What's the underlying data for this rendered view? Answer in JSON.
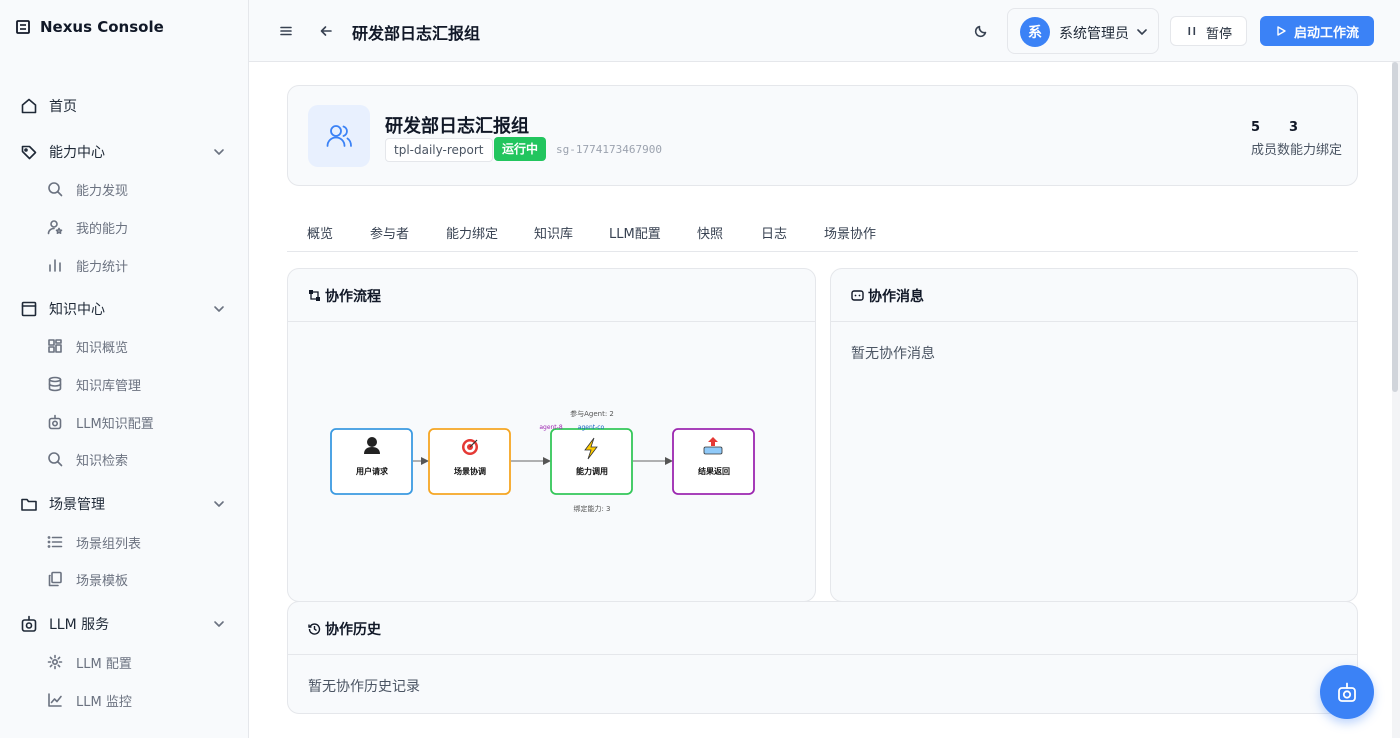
{
  "app": {
    "brand": "Nexus Console"
  },
  "sidebar": {
    "groups": [
      {
        "label": "首页",
        "icon": "home-icon"
      },
      {
        "label": "能力中心",
        "icon": "tag-icon",
        "items": [
          {
            "label": "能力发现",
            "icon": "search-icon"
          },
          {
            "label": "我的能力",
            "icon": "user-star-icon"
          },
          {
            "label": "能力统计",
            "icon": "bar-chart-icon"
          }
        ]
      },
      {
        "label": "知识中心",
        "icon": "book-icon",
        "items": [
          {
            "label": "知识概览",
            "icon": "grid-icon"
          },
          {
            "label": "知识库管理",
            "icon": "database-icon"
          },
          {
            "label": "LLM知识配置",
            "icon": "robot-icon"
          },
          {
            "label": "知识检索",
            "icon": "search-icon"
          }
        ]
      },
      {
        "label": "场景管理",
        "icon": "folder-icon",
        "items": [
          {
            "label": "场景组列表",
            "icon": "list-icon"
          },
          {
            "label": "场景模板",
            "icon": "copy-icon"
          }
        ]
      },
      {
        "label": "LLM 服务",
        "icon": "robot-icon",
        "items": [
          {
            "label": "LLM 配置",
            "icon": "gear-icon"
          },
          {
            "label": "LLM 监控",
            "icon": "line-chart-icon"
          }
        ]
      }
    ]
  },
  "header": {
    "title": "研发部日志汇报组",
    "user": {
      "avatar_char": "系",
      "name": "系统管理员"
    },
    "pause_label": "暂停",
    "start_label": "启动工作流"
  },
  "group_info": {
    "name": "研发部日志汇报组",
    "template": "tpl-daily-report",
    "status": "运行中",
    "id": "sg-1774173467900",
    "members": "5",
    "capabilities": "3",
    "stats_label": "成员数能力绑定"
  },
  "tabs": [
    "概览",
    "参与者",
    "能力绑定",
    "知识库",
    "LLM配置",
    "快照",
    "日志",
    "场景协作"
  ],
  "flow_panel": {
    "title": "协作流程",
    "nodes": [
      {
        "label": "用户请求",
        "color": "#3b9ae1",
        "icon": "user-icon"
      },
      {
        "label": "场景协调",
        "color": "#f5a623",
        "icon": "target-icon"
      },
      {
        "label": "能力调用",
        "color": "#34c759",
        "icon": "lightning-icon"
      },
      {
        "label": "结果返回",
        "color": "#9c27b0",
        "icon": "upload-icon"
      }
    ],
    "agent_count_label": "参与Agent: 2",
    "agent_tags": [
      "agent-8",
      "agent-co"
    ],
    "binding_label": "绑定能力: 3"
  },
  "messages_panel": {
    "title": "协作消息",
    "empty_text": "暂无协作消息"
  },
  "history_panel": {
    "title": "协作历史",
    "empty_text": "暂无协作历史记录"
  }
}
